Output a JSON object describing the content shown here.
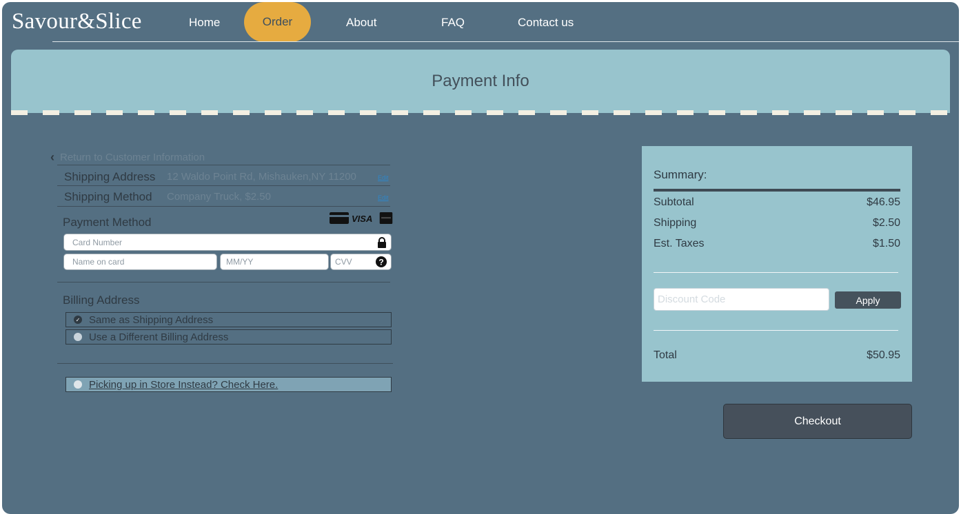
{
  "header": {
    "logo": "Savour&Slice",
    "nav": [
      "Home",
      "Order",
      "About",
      "FAQ",
      "Contact us"
    ],
    "active": "Order"
  },
  "banner": {
    "title": "Payment Info"
  },
  "checkout": {
    "return_link": "Return to Customer Information",
    "shipping_address_label": "Shipping Address",
    "shipping_address_value": "12 Waldo Point Rd, Mishauken,NY 11200",
    "shipping_method_label": "Shipping Method",
    "shipping_method_value": "Company Truck, $2.50",
    "edit_label": "Edit",
    "payment_method_label": "Payment Method",
    "card_icons": [
      "credit-card-icon",
      "visa-icon",
      "amex-icon"
    ],
    "card_number_placeholder": "Card Number",
    "name_placeholder": "Name on card",
    "expiry_placeholder": "MM/YY",
    "cvv_placeholder": "CVV",
    "billing_label": "Billing Address",
    "billing_options": [
      "Same as Shipping Address",
      "Use a Different Billing Address"
    ],
    "billing_selected": "Same as Shipping Address",
    "pickup_label": "Picking up in Store Instead? Check Here."
  },
  "summary": {
    "title": "Summary:",
    "subtotal_label": "Subtotal",
    "subtotal": "$46.95",
    "shipping_label": "Shipping",
    "shipping": "$2.50",
    "taxes_label": "Est. Taxes",
    "taxes": "$1.50",
    "discount_placeholder": "Discount Code",
    "apply_label": "Apply",
    "total_label": "Total",
    "total": "$50.95"
  },
  "checkout_button": "Checkout",
  "colors": {
    "background": "#546f82",
    "panel": "#98c4cd",
    "accent": "#e6ab40",
    "button": "#46505b"
  }
}
